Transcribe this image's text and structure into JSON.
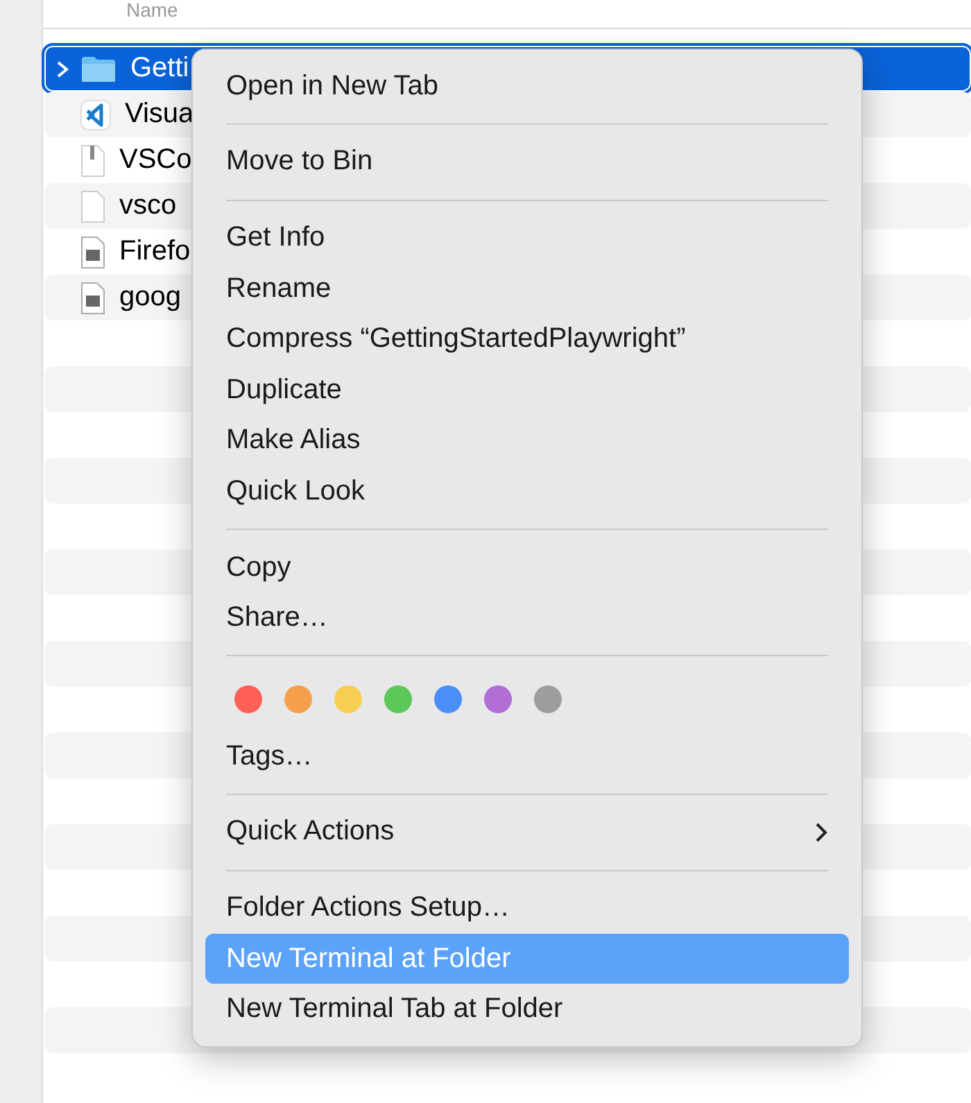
{
  "list_header": {
    "label": "Name"
  },
  "files": [
    {
      "name": "Getti",
      "kind": "folder",
      "selected": true,
      "expanded": false
    },
    {
      "name": "Visua",
      "kind": "app",
      "selected": false
    },
    {
      "name": "VSCo",
      "kind": "archive",
      "selected": false
    },
    {
      "name": "vsco",
      "kind": "blank",
      "selected": false
    },
    {
      "name": "Firefo",
      "kind": "image-doc",
      "selected": false
    },
    {
      "name": "goog",
      "kind": "image-doc",
      "selected": false
    }
  ],
  "context_menu": {
    "items": [
      {
        "kind": "item",
        "label": "Open in New Tab",
        "selected": false
      },
      {
        "kind": "separator"
      },
      {
        "kind": "item",
        "label": "Move to Bin",
        "selected": false
      },
      {
        "kind": "separator"
      },
      {
        "kind": "item",
        "label": "Get Info",
        "selected": false
      },
      {
        "kind": "item",
        "label": "Rename",
        "selected": false
      },
      {
        "kind": "item",
        "label": "Compress “GettingStartedPlaywright”",
        "selected": false
      },
      {
        "kind": "item",
        "label": "Duplicate",
        "selected": false
      },
      {
        "kind": "item",
        "label": "Make Alias",
        "selected": false
      },
      {
        "kind": "item",
        "label": "Quick Look",
        "selected": false
      },
      {
        "kind": "separator"
      },
      {
        "kind": "item",
        "label": "Copy",
        "selected": false
      },
      {
        "kind": "item",
        "label": "Share…",
        "selected": false
      },
      {
        "kind": "separator"
      },
      {
        "kind": "tags",
        "tags": [
          {
            "color": "#fe5f57"
          },
          {
            "color": "#f7a04b"
          },
          {
            "color": "#f8ce52"
          },
          {
            "color": "#5ac95a"
          },
          {
            "color": "#4a8ef6"
          },
          {
            "color": "#b06ed6"
          },
          {
            "color": "#9d9da0"
          }
        ]
      },
      {
        "kind": "item",
        "label": "Tags…",
        "selected": false
      },
      {
        "kind": "separator"
      },
      {
        "kind": "submenu",
        "label": "Quick Actions",
        "selected": false
      },
      {
        "kind": "separator"
      },
      {
        "kind": "item",
        "label": "Folder Actions Setup…",
        "selected": false
      },
      {
        "kind": "item",
        "label": "New Terminal at Folder",
        "selected": true
      },
      {
        "kind": "item",
        "label": "New Terminal Tab at Folder",
        "selected": false
      }
    ]
  }
}
